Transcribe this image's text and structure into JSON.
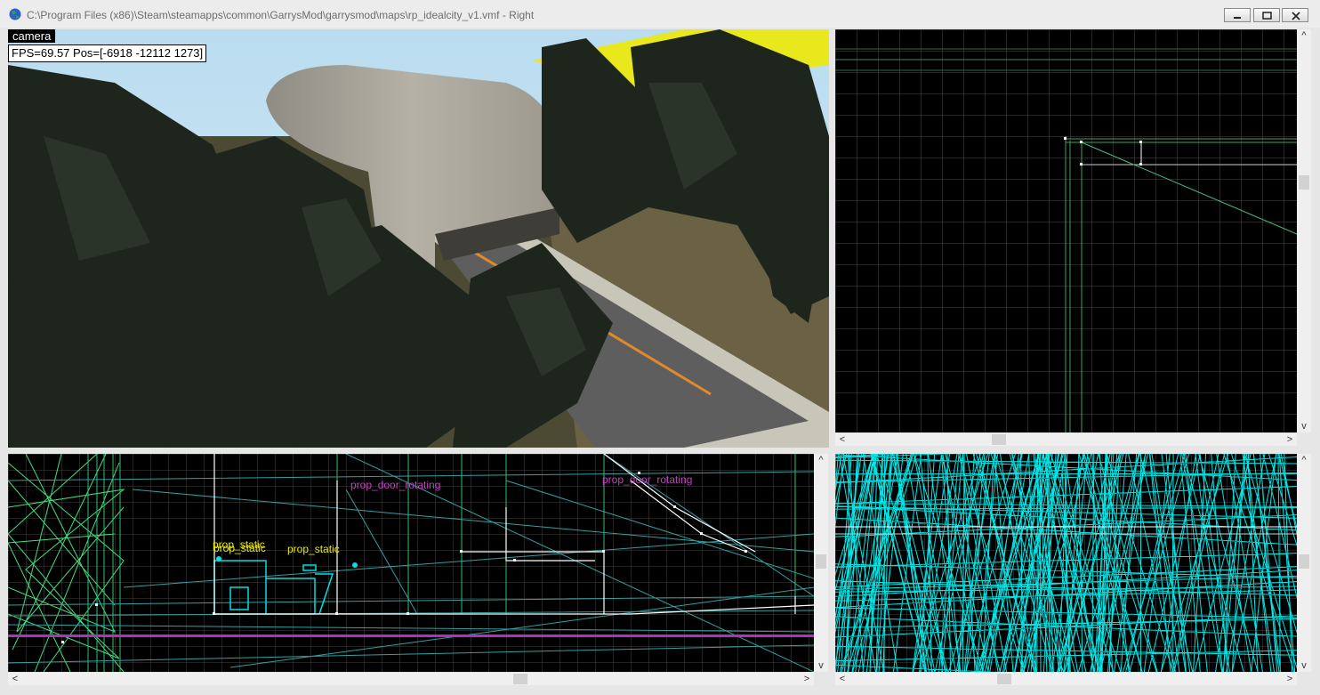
{
  "window": {
    "title": "C:\\Program Files (x86)\\Steam\\steamapps\\common\\GarrysMod\\garrysmod\\maps\\rp_idealcity_v1.vmf - Right",
    "icon": "globe-icon",
    "buttons": [
      "minimize-icon",
      "restore-icon",
      "close-icon"
    ]
  },
  "camera_view": {
    "label": "camera",
    "stats": "FPS=69.57 Pos=[-6918 -12112 1273]"
  },
  "side_view": {
    "entities": [
      {
        "label": "prop_static",
        "color": "#e8e800"
      },
      {
        "label": "prop_static",
        "color": "#e8e800"
      },
      {
        "label": "prop_static",
        "color": "#e8e800"
      },
      {
        "label": "prop_door_rotating",
        "color": "#c040c0"
      },
      {
        "label": "prop_door_rotating",
        "color": "#c040c0"
      }
    ]
  },
  "colors": {
    "grid": "#3a3a3a",
    "brush_green": "#40c080",
    "brush_cyan": "#00e0e0",
    "selection": "#ffffff",
    "title_text": "#6d6d6d"
  },
  "scrollbars": {
    "left_arrow": "<",
    "right_arrow": ">",
    "up_arrow": "^",
    "down_arrow": "v"
  }
}
